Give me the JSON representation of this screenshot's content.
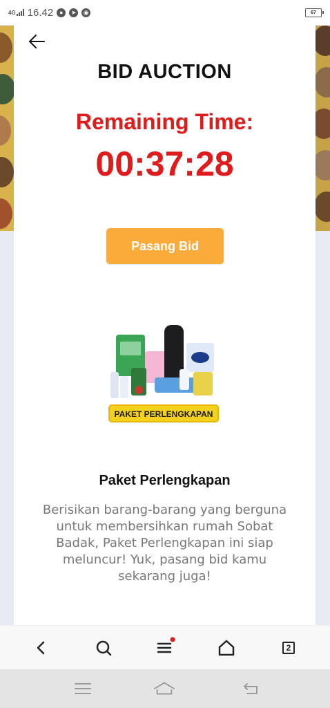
{
  "status_bar": {
    "network": "4G",
    "time": "16.42",
    "battery": "67"
  },
  "header": {
    "title": "BID AUCTION"
  },
  "countdown": {
    "label": "Remaining Time:",
    "value": "00:37:28"
  },
  "actions": {
    "bid_label": "Pasang Bid"
  },
  "product": {
    "image_label": "PAKET PERLENGKAPAN",
    "name": "Paket Perlengkapan",
    "description": "Berisikan barang-barang yang berguna untuk membersihkan rumah Sobat Badak, Paket Perlengkapan ini siap meluncur! Yuk, pasang bid kamu sekarang juga!"
  },
  "browser_toolbar": {
    "tab_count": "2",
    "icons": [
      "back-icon",
      "search-icon",
      "menu-icon",
      "home-icon",
      "tabs-icon"
    ],
    "notification_color": "#e01b1b"
  },
  "colors": {
    "accent_red": "#e01b1b",
    "button_orange": "#fbab3a"
  }
}
